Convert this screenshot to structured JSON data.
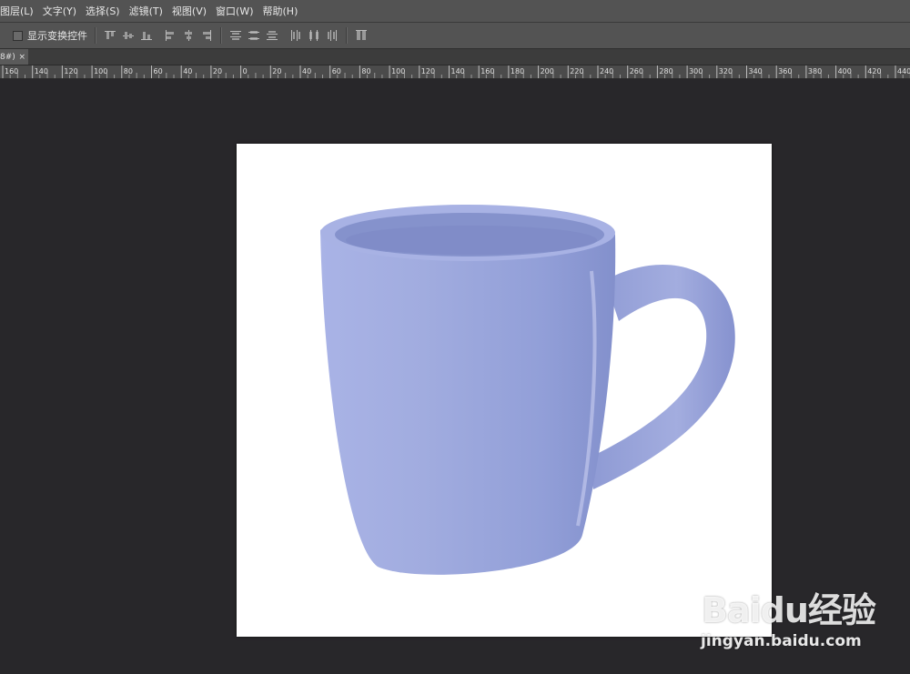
{
  "menu": [
    {
      "label": "图层(L)"
    },
    {
      "label": "文字(Y)"
    },
    {
      "label": "选择(S)"
    },
    {
      "label": "滤镜(T)"
    },
    {
      "label": "视图(V)"
    },
    {
      "label": "窗口(W)"
    },
    {
      "label": "帮助(H)"
    }
  ],
  "options": {
    "show_transform_label": "显示变换控件"
  },
  "document_tab": {
    "title": "8#)",
    "close": "×"
  },
  "ruler": {
    "ticks": [
      "160",
      "140",
      "120",
      "100",
      "80",
      "60",
      "40",
      "20",
      "0",
      "20",
      "40",
      "60",
      "80",
      "100",
      "120",
      "140",
      "160",
      "180",
      "200",
      "220",
      "240",
      "260",
      "280",
      "300",
      "320",
      "340",
      "360",
      "380",
      "400",
      "420",
      "440"
    ]
  },
  "watermark": {
    "logo": "Baidu经验",
    "url": "jingyan.baidu.com"
  },
  "colors": {
    "mug": "#9aa6dc",
    "mug_shadow": "#7f8cc8",
    "menubar": "#535353",
    "workspace": "#28272a"
  }
}
